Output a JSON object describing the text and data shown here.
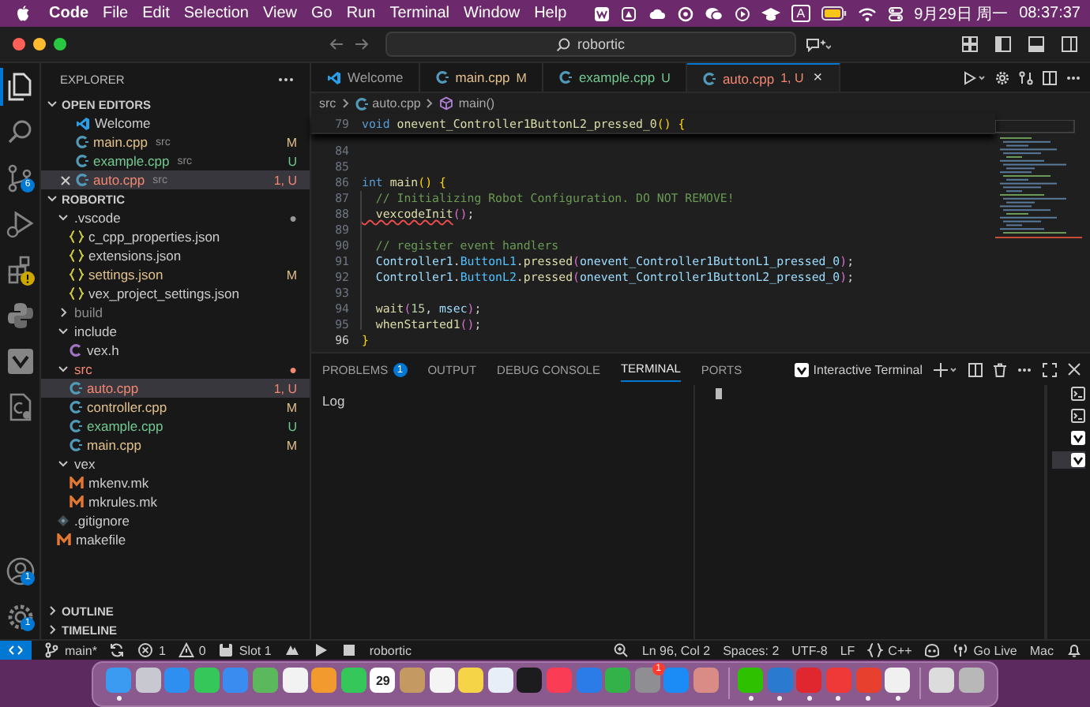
{
  "menu_bar": {
    "app_name": "Code",
    "menus": [
      "File",
      "Edit",
      "Selection",
      "View",
      "Go",
      "Run",
      "Terminal",
      "Window",
      "Help"
    ],
    "input_source": "A",
    "date": "9月29日 周一",
    "time": "08:37:37"
  },
  "title_bar": {
    "search": "robortic"
  },
  "activity_bar": {
    "items": [
      {
        "kind": "files",
        "selected": true
      },
      {
        "kind": "search",
        "selected": false
      },
      {
        "kind": "source-control",
        "selected": false,
        "badge": "6"
      },
      {
        "kind": "run",
        "selected": false
      },
      {
        "kind": "extensions",
        "selected": false,
        "alert": true
      },
      {
        "kind": "python",
        "selected": false
      },
      {
        "kind": "vex",
        "selected": false
      },
      {
        "kind": "cpp-page",
        "selected": false
      }
    ],
    "bottom": [
      {
        "kind": "account",
        "badge": "1"
      },
      {
        "kind": "gear",
        "badge": "1"
      }
    ]
  },
  "sidebar": {
    "title": "EXPLORER",
    "open_editors": {
      "title": "OPEN EDITORS",
      "expanded": true,
      "items": [
        {
          "name": "Welcome",
          "kind": "welcome",
          "selected": false
        },
        {
          "name": "main.cpp",
          "folder": "src",
          "kind": "cpp",
          "color": "#e2c08d",
          "decoration": "M",
          "selected": false
        },
        {
          "name": "example.cpp",
          "folder": "src",
          "kind": "cpp",
          "color": "#73c991",
          "decoration": "U",
          "selected": false
        },
        {
          "name": "auto.cpp",
          "folder": "src",
          "kind": "cpp",
          "color": "#f48771",
          "decoration": "1, U",
          "selected": true
        }
      ]
    },
    "project": {
      "title": "ROBORTIC",
      "expanded": true,
      "tree": [
        {
          "name": ".vscode",
          "kind": "folder",
          "expanded": true,
          "decoration": "●",
          "selected": false,
          "children": [
            {
              "name": "c_cpp_properties.json",
              "kind": "json",
              "selected": false
            },
            {
              "name": "extensions.json",
              "kind": "json",
              "selected": false
            },
            {
              "name": "settings.json",
              "kind": "json",
              "color": "#e2c08d",
              "decoration": "M",
              "selected": false
            },
            {
              "name": "vex_project_settings.json",
              "kind": "json",
              "selected": false
            }
          ]
        },
        {
          "name": "build",
          "kind": "folder",
          "expanded": false,
          "color": "#8c8c8c",
          "selected": false
        },
        {
          "name": "include",
          "kind": "folder",
          "expanded": true,
          "selected": false,
          "children": [
            {
              "name": "vex.h",
              "kind": "h",
              "selected": false
            }
          ]
        },
        {
          "name": "src",
          "kind": "folder",
          "expanded": true,
          "color": "#f48771",
          "decoration": "●",
          "selected": false,
          "children": [
            {
              "name": "auto.cpp",
              "kind": "cpp",
              "color": "#f48771",
              "decoration": "1, U",
              "selected": true
            },
            {
              "name": "controller.cpp",
              "kind": "cpp",
              "color": "#e2c08d",
              "decoration": "M",
              "selected": false
            },
            {
              "name": "example.cpp",
              "kind": "cpp",
              "color": "#73c991",
              "decoration": "U",
              "selected": false
            },
            {
              "name": "main.cpp",
              "kind": "cpp",
              "color": "#e2c08d",
              "decoration": "M",
              "selected": false
            }
          ]
        },
        {
          "name": "vex",
          "kind": "folder",
          "expanded": true,
          "selected": false,
          "children": [
            {
              "name": "mkenv.mk",
              "kind": "make",
              "selected": false
            },
            {
              "name": "mkrules.mk",
              "kind": "make",
              "selected": false
            }
          ]
        },
        {
          "name": ".gitignore",
          "kind": "git",
          "selected": false
        },
        {
          "name": "makefile",
          "kind": "make",
          "selected": false
        }
      ]
    },
    "collapsed_sections": [
      {
        "title": "OUTLINE",
        "expanded": false
      },
      {
        "title": "TIMELINE",
        "expanded": false
      }
    ]
  },
  "editor": {
    "tabs": [
      {
        "label": "Welcome",
        "kind": "welcome",
        "selected": false
      },
      {
        "label": "main.cpp",
        "kind": "cpp",
        "color": "#e2c08d",
        "decoration": "M",
        "selected": false
      },
      {
        "label": "example.cpp",
        "kind": "cpp",
        "color": "#73c991",
        "decoration": "U",
        "selected": false
      },
      {
        "label": "auto.cpp",
        "kind": "cpp",
        "color": "#f48771",
        "decoration": "1, U",
        "selected": true,
        "close": "×"
      }
    ],
    "breadcrumb": [
      {
        "text": "src",
        "kind": "folder"
      },
      {
        "text": "auto.cpp",
        "kind": "cpp"
      },
      {
        "text": "main()",
        "kind": "function"
      }
    ],
    "sticky_line": {
      "number": "79",
      "current": false,
      "tokens": [
        {
          "kind": "keyword",
          "text": "void "
        },
        {
          "kind": "function",
          "text": "onevent_Controller1ButtonL2_pressed_0"
        },
        {
          "kind": "bracket1",
          "text": "() {"
        }
      ]
    },
    "lines": [
      {
        "number": "84",
        "current": false
      },
      {
        "number": "85",
        "current": false
      },
      {
        "number": "86",
        "current": false,
        "tokens": [
          {
            "kind": "keyword",
            "text": "int "
          },
          {
            "kind": "function",
            "text": "main"
          },
          {
            "kind": "bracket1",
            "text": "() {"
          }
        ]
      },
      {
        "number": "87",
        "current": false,
        "tokens": [
          {
            "kind": "comment",
            "text": "  // Initializing Robot Configuration. DO NOT REMOVE!"
          }
        ]
      },
      {
        "number": "88",
        "current": false,
        "tokens": [
          {
            "kind": "function",
            "text": "  vexcodeInit",
            "error": true
          },
          {
            "kind": "bracket2",
            "text": "()"
          },
          {
            "kind": "plain",
            "text": ";"
          }
        ]
      },
      {
        "number": "89",
        "current": false
      },
      {
        "number": "90",
        "current": false,
        "tokens": [
          {
            "kind": "comment",
            "text": "  // register event handlers"
          }
        ]
      },
      {
        "number": "91",
        "current": false,
        "tokens": [
          {
            "kind": "variable",
            "text": "  Controller1"
          },
          {
            "kind": "plain",
            "text": "."
          },
          {
            "kind": "member",
            "text": "ButtonL1"
          },
          {
            "kind": "plain",
            "text": "."
          },
          {
            "kind": "function",
            "text": "pressed"
          },
          {
            "kind": "bracket2",
            "text": "("
          },
          {
            "kind": "variable",
            "text": "onevent_Controller1ButtonL1_pressed_0"
          },
          {
            "kind": "bracket2",
            "text": ")"
          },
          {
            "kind": "plain",
            "text": ";"
          }
        ]
      },
      {
        "number": "92",
        "current": false,
        "tokens": [
          {
            "kind": "variable",
            "text": "  Controller1"
          },
          {
            "kind": "plain",
            "text": "."
          },
          {
            "kind": "member",
            "text": "ButtonL2"
          },
          {
            "kind": "plain",
            "text": "."
          },
          {
            "kind": "function",
            "text": "pressed"
          },
          {
            "kind": "bracket2",
            "text": "("
          },
          {
            "kind": "variable",
            "text": "onevent_Controller1ButtonL2_pressed_0"
          },
          {
            "kind": "bracket2",
            "text": ")"
          },
          {
            "kind": "plain",
            "text": ";"
          }
        ]
      },
      {
        "number": "93",
        "current": false
      },
      {
        "number": "94",
        "current": false,
        "tokens": [
          {
            "kind": "function",
            "text": "  wait"
          },
          {
            "kind": "bracket2",
            "text": "("
          },
          {
            "kind": "number",
            "text": "15"
          },
          {
            "kind": "plain",
            "text": ", "
          },
          {
            "kind": "variable",
            "text": "msec"
          },
          {
            "kind": "bracket2",
            "text": ")"
          },
          {
            "kind": "plain",
            "text": ";"
          }
        ]
      },
      {
        "number": "95",
        "current": false,
        "tokens": [
          {
            "kind": "function",
            "text": "  whenStarted1"
          },
          {
            "kind": "bracket2",
            "text": "()"
          },
          {
            "kind": "plain",
            "text": ";"
          }
        ]
      },
      {
        "number": "96",
        "current": true,
        "tokens": [
          {
            "kind": "bracket1",
            "text": "}"
          }
        ]
      }
    ]
  },
  "panel": {
    "tabs": [
      {
        "label": "PROBLEMS",
        "badge": "1",
        "selected": false
      },
      {
        "label": "OUTPUT",
        "selected": false
      },
      {
        "label": "DEBUG CONSOLE",
        "selected": false
      },
      {
        "label": "TERMINAL",
        "selected": true
      },
      {
        "label": "PORTS",
        "selected": false
      }
    ],
    "terminal_name": "Interactive Terminal",
    "log_text": "Log",
    "terminals": [
      {
        "kind": "shell",
        "selected": false
      },
      {
        "kind": "shell",
        "selected": false
      },
      {
        "kind": "vex",
        "selected": false
      },
      {
        "kind": "vex",
        "selected": true
      }
    ]
  },
  "status_bar": {
    "left": [
      {
        "kind": "remote"
      },
      {
        "kind": "branch",
        "text": "main*"
      },
      {
        "kind": "sync"
      },
      {
        "kind": "errors",
        "text": "1"
      },
      {
        "kind": "warnings",
        "text": "0"
      },
      {
        "kind": "slot",
        "text": "Slot 1"
      },
      {
        "kind": "build"
      },
      {
        "kind": "play"
      },
      {
        "kind": "stop"
      },
      {
        "kind": "label",
        "text": "robortic"
      }
    ],
    "right": [
      {
        "kind": "zoom"
      },
      {
        "kind": "label",
        "text": "Ln 96, Col 2"
      },
      {
        "kind": "label",
        "text": "Spaces: 2"
      },
      {
        "kind": "label",
        "text": "UTF-8"
      },
      {
        "kind": "label",
        "text": "LF"
      },
      {
        "kind": "language",
        "text": "C++"
      },
      {
        "kind": "copilot"
      },
      {
        "kind": "live",
        "text": "Go Live"
      },
      {
        "kind": "label",
        "text": "Mac"
      },
      {
        "kind": "bell"
      }
    ]
  },
  "dock": {
    "apps": [
      {
        "kind": "app",
        "color": "#3a9bf0",
        "running": true
      },
      {
        "kind": "app",
        "color": "#c8c8d0",
        "running": false
      },
      {
        "kind": "app",
        "color": "#2f8ff0",
        "running": false
      },
      {
        "kind": "app",
        "color": "#35c759",
        "running": false
      },
      {
        "kind": "app",
        "color": "#3b8cf0",
        "running": false
      },
      {
        "kind": "app",
        "color": "#5cb85c",
        "running": false
      },
      {
        "kind": "app",
        "color": "#f2f2f2",
        "running": false
      },
      {
        "kind": "app",
        "color": "#f29a2e",
        "running": false
      },
      {
        "kind": "app",
        "color": "#35c759",
        "running": false
      },
      {
        "kind": "calendar",
        "text": "29",
        "color": "#ffffff",
        "running": false
      },
      {
        "kind": "app",
        "color": "#c59a62",
        "running": false
      },
      {
        "kind": "app",
        "color": "#f4f4f4",
        "running": false
      },
      {
        "kind": "app",
        "color": "#f5d547",
        "running": false
      },
      {
        "kind": "app",
        "color": "#e8eef8",
        "running": false
      },
      {
        "kind": "app",
        "color": "#1c1c1e",
        "running": false
      },
      {
        "kind": "app",
        "color": "#fa3c55",
        "running": false
      },
      {
        "kind": "app",
        "color": "#2b7ce9",
        "running": false
      },
      {
        "kind": "app",
        "color": "#33b24a",
        "running": false
      },
      {
        "kind": "app",
        "color": "#8e8e93",
        "running": false,
        "badge": "1"
      },
      {
        "kind": "app",
        "color": "#1b8cf5",
        "running": false
      },
      {
        "kind": "app",
        "color": "#d98c86",
        "running": false
      },
      {
        "kind": "separator"
      },
      {
        "kind": "app",
        "color": "#2dc100",
        "running": true
      },
      {
        "kind": "app",
        "color": "#2a7ad0",
        "running": true
      },
      {
        "kind": "app",
        "color": "#e0262e",
        "running": true
      },
      {
        "kind": "app",
        "color": "#ef3939",
        "running": true
      },
      {
        "kind": "app",
        "color": "#e8402e",
        "running": true
      },
      {
        "kind": "app",
        "color": "#f0f0f0",
        "running": true
      },
      {
        "kind": "separator"
      },
      {
        "kind": "app",
        "color": "#dcdcdc",
        "running": false
      },
      {
        "kind": "app",
        "color": "#b8b8b8",
        "running": false
      }
    ]
  }
}
